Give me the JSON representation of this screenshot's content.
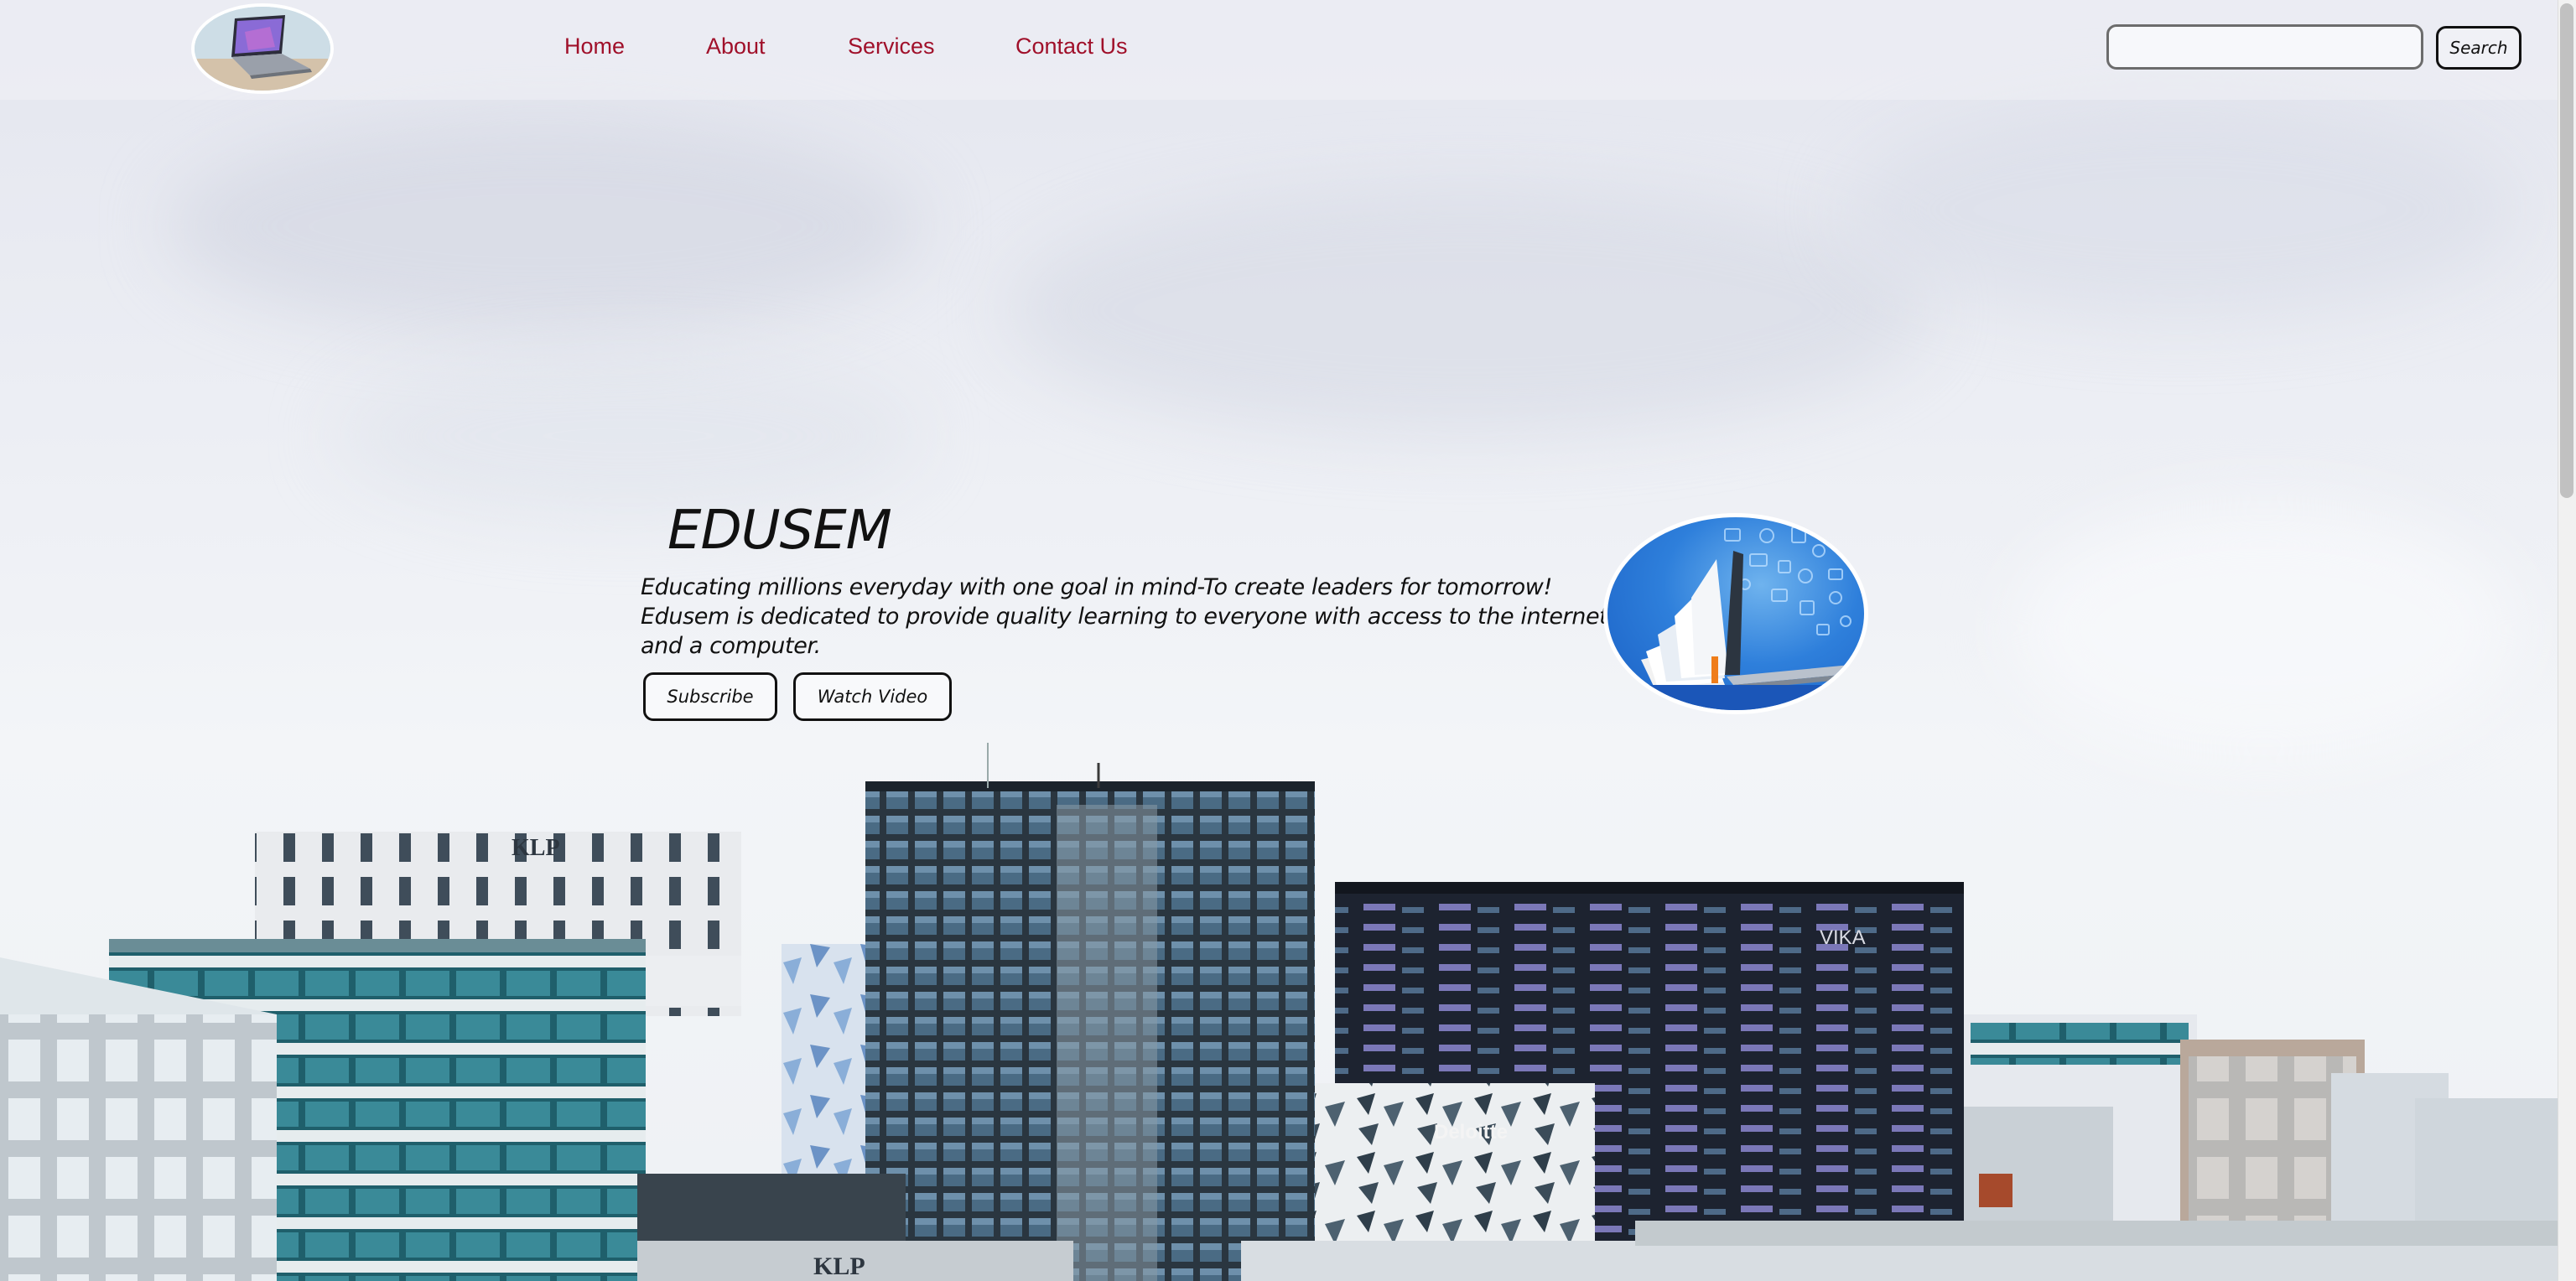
{
  "nav": {
    "items": [
      {
        "label": "Home"
      },
      {
        "label": "About"
      },
      {
        "label": "Services"
      },
      {
        "label": "Contact Us"
      }
    ]
  },
  "search": {
    "value": "",
    "placeholder": "",
    "button_label": "Search"
  },
  "hero": {
    "title": "EDUSEM",
    "lines": [
      "Educating millions everyday with one goal in mind-To create leaders for tomorrow!",
      "Edusem is dedicated to provide quality learning to everyone with access to the internet",
      "and a computer."
    ],
    "subscribe_label": "Subscribe",
    "watch_label": "Watch Video"
  },
  "buildings": {
    "signs": [
      "Deloitte",
      "KLP",
      "KLP",
      "VIKA"
    ]
  },
  "colors": {
    "nav_link": "#a0102a",
    "text": "#111111",
    "hero_image_blue": "#2e7fdb"
  },
  "icons": {
    "logo": "laptop-logo-icon",
    "hero": "book-laptop-icon"
  }
}
